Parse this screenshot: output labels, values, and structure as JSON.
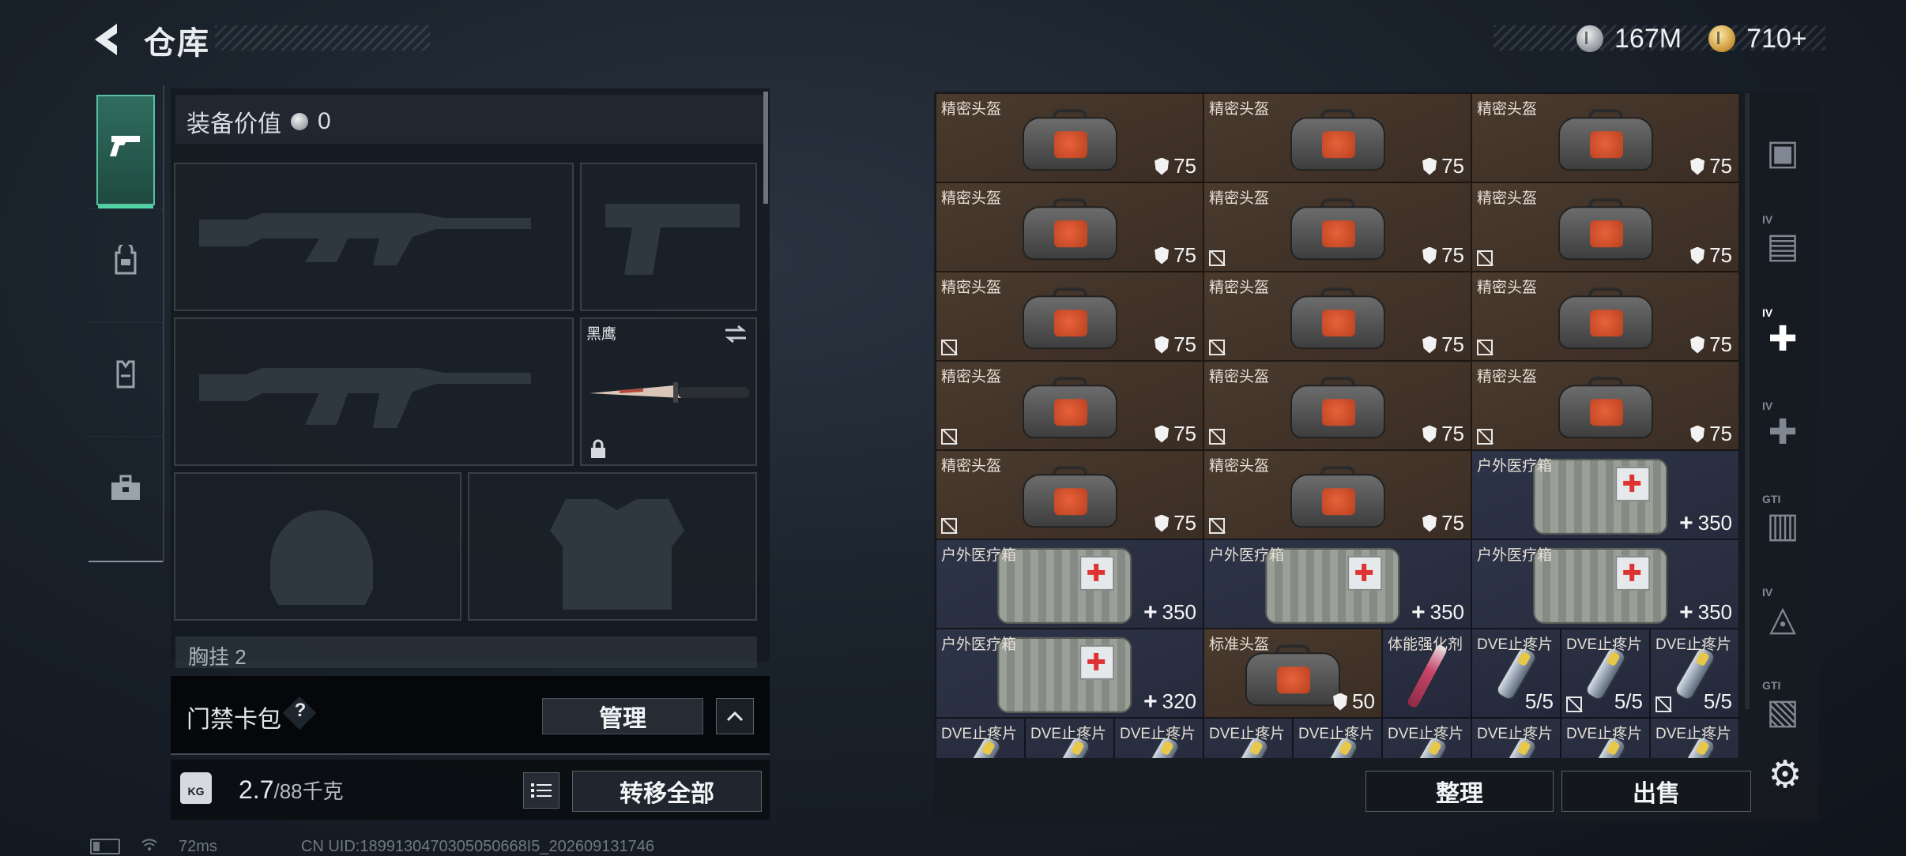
{
  "header": {
    "title": "仓库",
    "currency_silver": "167M",
    "currency_gold": "710+"
  },
  "side_tabs": [
    {
      "icon": "pistol-icon",
      "active": true
    },
    {
      "icon": "backpack-icon",
      "active": false
    },
    {
      "icon": "vest-icon",
      "active": false
    },
    {
      "icon": "toolbox-icon",
      "active": false
    }
  ],
  "equipment": {
    "value_label": "装备价值",
    "value": "0",
    "knife_name": "黑鹰",
    "chest_label": "胸挂  2"
  },
  "keycard": {
    "label": "门禁卡包",
    "help": "?",
    "manage": "管理"
  },
  "capacity": {
    "current": "2.7",
    "max": "/88千克",
    "kg_badge": "KG",
    "transfer_all": "转移全部"
  },
  "status_bar": {
    "ping": "72ms",
    "uid": "CN UID:1899130470305050668I5_202609131746"
  },
  "storage": {
    "items": [
      {
        "name": "精密头盔",
        "type": "helmet",
        "value": "75",
        "uninsured": false
      },
      {
        "name": "精密头盔",
        "type": "helmet",
        "value": "75",
        "uninsured": false
      },
      {
        "name": "精密头盔",
        "type": "helmet",
        "value": "75",
        "uninsured": false
      },
      {
        "name": "精密头盔",
        "type": "helmet",
        "value": "75",
        "uninsured": false
      },
      {
        "name": "精密头盔",
        "type": "helmet",
        "value": "75",
        "uninsured": true
      },
      {
        "name": "精密头盔",
        "type": "helmet",
        "value": "75",
        "uninsured": true
      },
      {
        "name": "精密头盔",
        "type": "helmet",
        "value": "75",
        "uninsured": true
      },
      {
        "name": "精密头盔",
        "type": "helmet",
        "value": "75",
        "uninsured": true
      },
      {
        "name": "精密头盔",
        "type": "helmet",
        "value": "75",
        "uninsured": true
      },
      {
        "name": "精密头盔",
        "type": "helmet",
        "value": "75",
        "uninsured": true
      },
      {
        "name": "精密头盔",
        "type": "helmet",
        "value": "75",
        "uninsured": true
      },
      {
        "name": "精密头盔",
        "type": "helmet",
        "value": "75",
        "uninsured": true
      },
      {
        "name": "精密头盔",
        "type": "helmet",
        "value": "75",
        "uninsured": true
      },
      {
        "name": "精密头盔",
        "type": "helmet",
        "value": "75",
        "uninsured": true
      },
      {
        "name": "户外医疗箱",
        "type": "medkit",
        "value": "350",
        "uninsured": false
      },
      {
        "name": "户外医疗箱",
        "type": "medkit",
        "value": "350",
        "uninsured": false
      },
      {
        "name": "户外医疗箱",
        "type": "medkit",
        "value": "350",
        "uninsured": false
      },
      {
        "name": "户外医疗箱",
        "type": "medkit",
        "value": "350",
        "uninsured": false
      },
      {
        "name": "户外医疗箱",
        "type": "medkit",
        "value": "320",
        "uninsured": false
      },
      {
        "name": "标准头盔",
        "type": "helmet-small",
        "value": "50",
        "uninsured": false
      },
      {
        "name": "体能强化剂",
        "type": "syringe",
        "value": "",
        "uninsured": false
      },
      {
        "name": "DVE止疼片",
        "type": "pill",
        "value": "5/5",
        "uninsured": false
      },
      {
        "name": "DVE止疼片",
        "type": "pill",
        "value": "5/5",
        "uninsured": true
      },
      {
        "name": "DVE止疼片",
        "type": "pill",
        "value": "5/5",
        "uninsured": true
      },
      {
        "name": "DVE止疼片",
        "type": "pill",
        "value": "",
        "uninsured": false
      },
      {
        "name": "DVE止疼片",
        "type": "pill",
        "value": "",
        "uninsured": false
      },
      {
        "name": "DVE止疼片",
        "type": "pill",
        "value": "",
        "uninsured": false
      },
      {
        "name": "DVE止疼片",
        "type": "pill",
        "value": "",
        "uninsured": false
      },
      {
        "name": "DVE止疼片",
        "type": "pill",
        "value": "",
        "uninsured": false
      },
      {
        "name": "DVE止疼片",
        "type": "pill",
        "value": "",
        "uninsured": false
      },
      {
        "name": "DVE止疼片",
        "type": "pill",
        "value": "",
        "uninsured": false
      },
      {
        "name": "DVE止疼片",
        "type": "pill",
        "value": "",
        "uninsured": false
      },
      {
        "name": "DVE止疼片",
        "type": "pill",
        "value": "",
        "uninsured": false
      }
    ]
  },
  "rail": {
    "icons": [
      "helmet-category-icon",
      "ammo-iv-icon",
      "medical-iv-plus-icon",
      "medical-iv-icon",
      "gti-icon",
      "armor-iv-icon",
      "gti-armor-icon"
    ],
    "tags": [
      "IV",
      "IV",
      "IV",
      "GTI",
      "IV",
      "GTI"
    ]
  },
  "actions": {
    "sort": "整理",
    "sell": "出售"
  },
  "colors": {
    "helmet_cell": "#3f3128",
    "med_cell": "#2a3044",
    "active_tab": "#2f6d5e",
    "accent": "#4fd4a3"
  }
}
